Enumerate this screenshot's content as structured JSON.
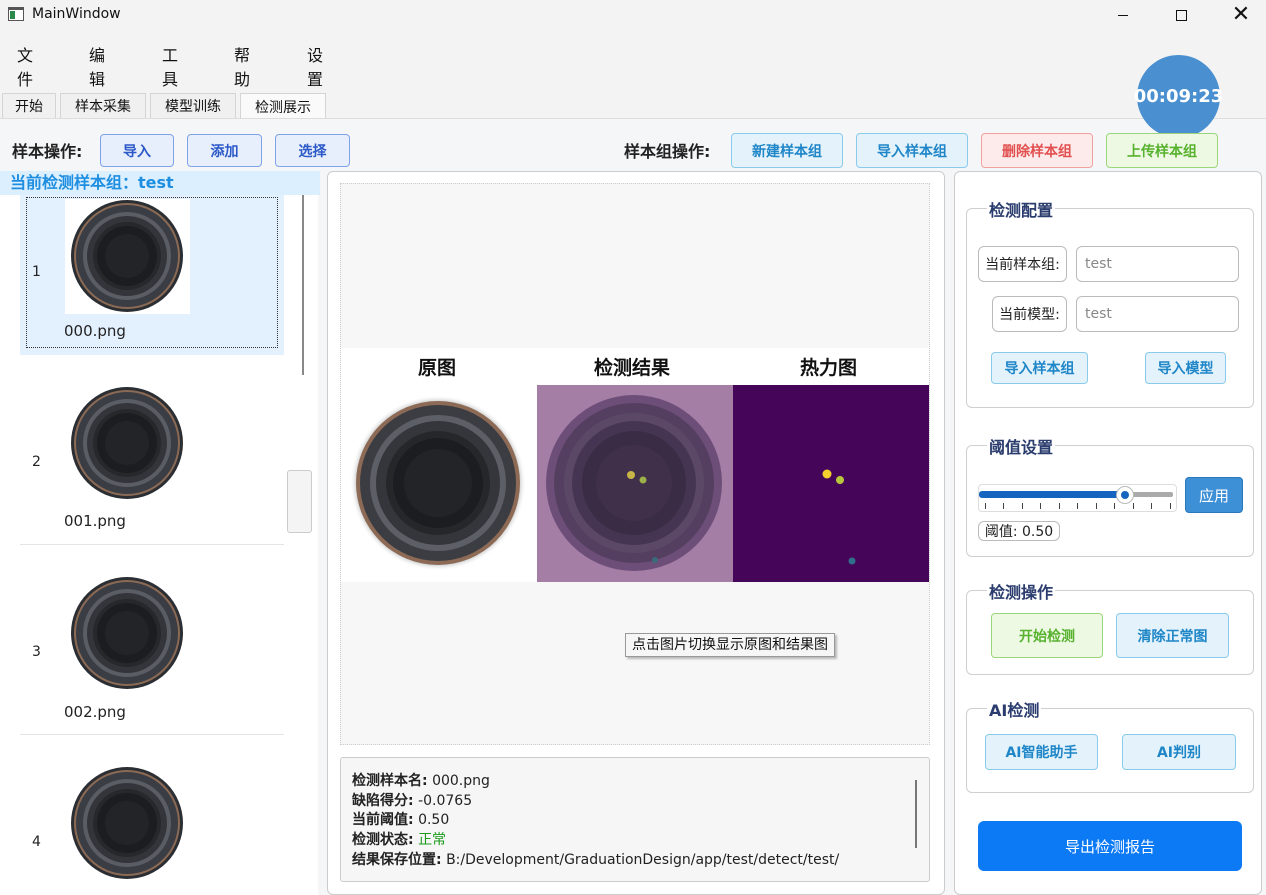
{
  "window": {
    "title": "MainWindow"
  },
  "menu": {
    "items": [
      "文件",
      "编辑",
      "工具",
      "帮助",
      "设置"
    ]
  },
  "timer": {
    "value": "00:09:23"
  },
  "tabs": [
    {
      "label": "开始",
      "active": false
    },
    {
      "label": "样本采集",
      "active": false
    },
    {
      "label": "模型训练",
      "active": false
    },
    {
      "label": "检测展示",
      "active": true
    }
  ],
  "toolbar": {
    "sample_ops_label": "样本操作:",
    "import_label": "导入",
    "add_label": "添加",
    "select_label": "选择",
    "group_ops_label": "样本组操作:",
    "new_group_label": "新建样本组",
    "import_group_label": "导入样本组",
    "delete_group_label": "删除样本组",
    "upload_group_label": "上传样本组"
  },
  "sample_list": {
    "header": "当前检测样本组：test",
    "items": [
      {
        "index": "1",
        "file": "000.png",
        "selected": true
      },
      {
        "index": "2",
        "file": "001.png",
        "selected": false
      },
      {
        "index": "3",
        "file": "002.png",
        "selected": false
      },
      {
        "index": "4",
        "file": "",
        "selected": false
      }
    ]
  },
  "preview": {
    "titles": [
      "原图",
      "检测结果",
      "热力图"
    ],
    "tooltip": "点击图片切换显示原图和结果图"
  },
  "info": {
    "name_label": "检测样本名:",
    "name_value": "000.png",
    "score_label": "缺陷得分:",
    "score_value": "-0.0765",
    "threshold_label": "当前阈值:",
    "threshold_value": "0.50",
    "status_label": "检测状态:",
    "status_value": "正常",
    "path_label": "结果保存位置:",
    "path_value": "B:/Development/GraduationDesign/app/test/detect/test/"
  },
  "config": {
    "title": "检测配置",
    "group_label": "当前样本组:",
    "group_value": "test",
    "model_label": "当前模型:",
    "model_value": "test",
    "import_group_btn": "导入样本组",
    "import_model_btn": "导入模型"
  },
  "threshold": {
    "title": "阈值设置",
    "apply_btn": "应用",
    "value_text": "阈值: 0.50",
    "slider_fraction": 0.75
  },
  "detect_ops": {
    "title": "检测操作",
    "start_btn": "开始检测",
    "clear_btn": "清除正常图"
  },
  "ai": {
    "title": "AI检测",
    "assistant_btn": "AI智能助手",
    "judge_btn": "AI判别"
  },
  "export": {
    "label": "导出检测报告"
  },
  "colors": {
    "accent": "#1e8ee0",
    "export_btn": "#0d7af5",
    "status_ok": "#1a9b1a",
    "timer_bg": "#4a90d0"
  }
}
